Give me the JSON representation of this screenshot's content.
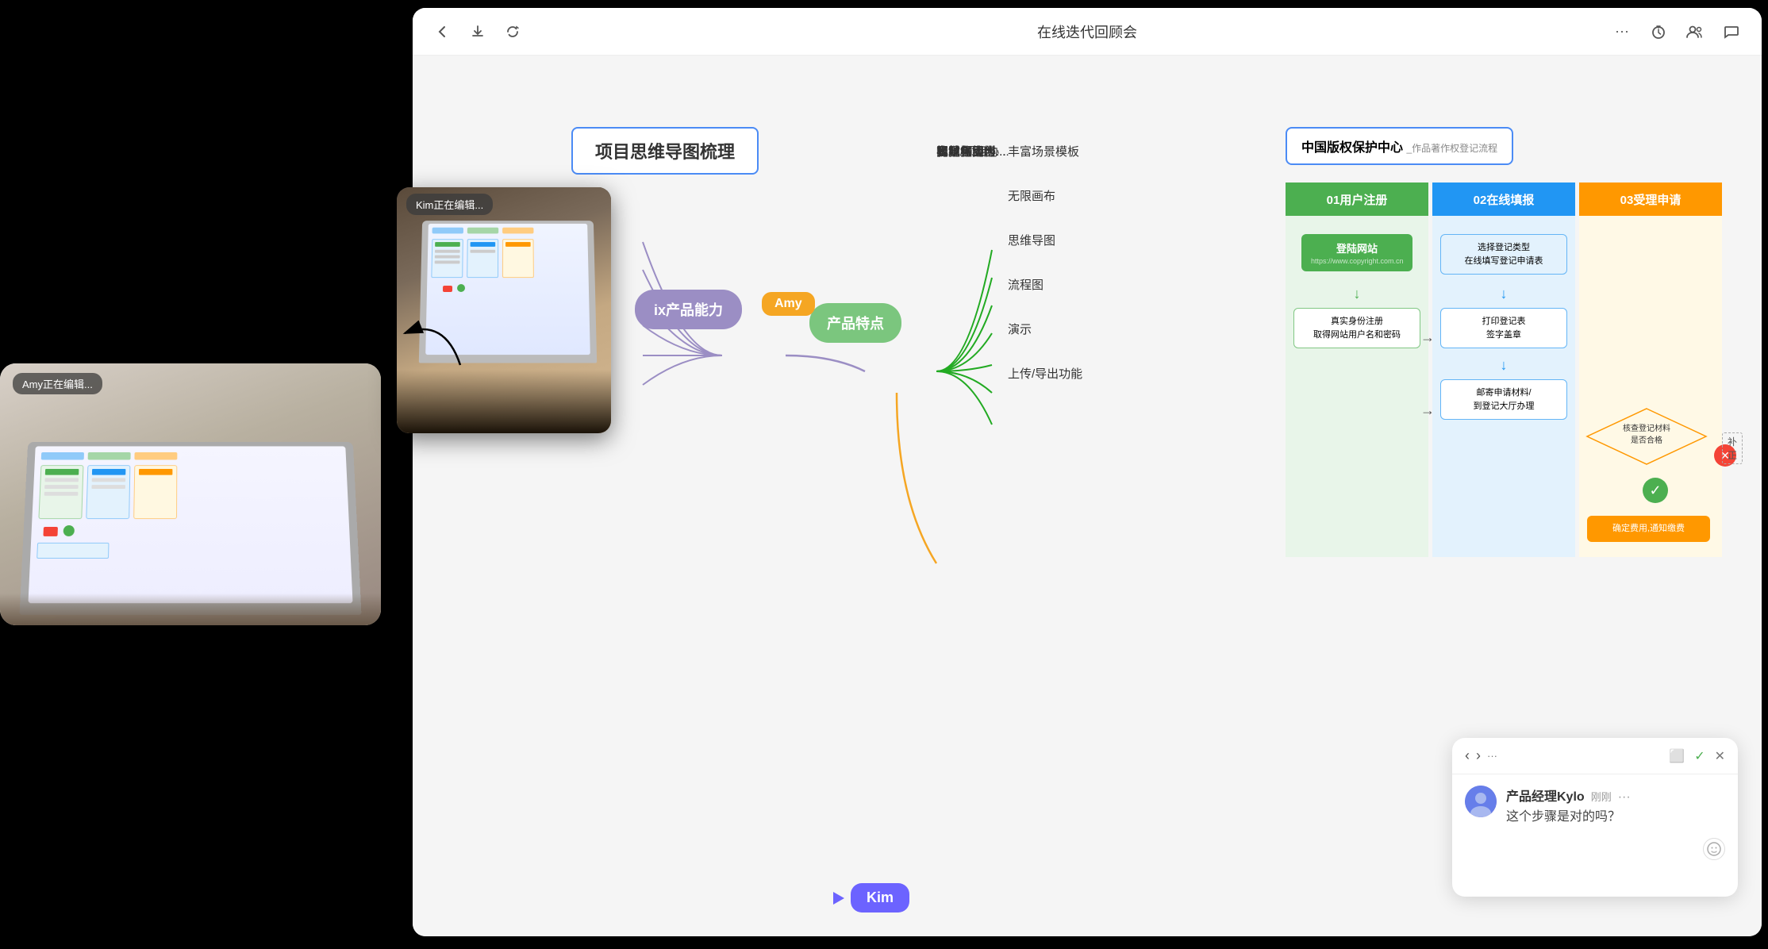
{
  "app": {
    "title": "在线迭代回顾会",
    "background": "#000000"
  },
  "titlebar": {
    "back_icon": "←",
    "download_icon": "↓",
    "sync_icon": "⟳",
    "more_icon": "···",
    "timer_icon": "⏱",
    "users_icon": "👥",
    "chat_icon": "💬"
  },
  "mindmap": {
    "title": "项目思维导图梳理",
    "central_node": "ix产品能力",
    "product_node": "产品特点",
    "amy_label": "Amy",
    "branches_left": [
      "丰富场景模板",
      "无限画布",
      "思维导图",
      "流程图",
      "演示",
      "上传/导出功能"
    ],
    "branches_right": [
      "实时在线协...",
      "异地协同",
      "视觉化协作",
      "有趣且实用...",
      "团队/项目协...",
      "简单易用、...",
      "音视频实时..."
    ]
  },
  "copyright": {
    "title": "中国版权保护中心",
    "subtitle": "_作品著作权登记流程",
    "step1": "01用户注册",
    "step2": "02在线填报",
    "step3": "03受理申请",
    "login_btn": "登陆网站",
    "login_url": "https://www.copyright.com.cn",
    "flow_items": [
      "真实身份注册\n取得网站用户名和密码",
      "选择登记类型\n在线填写登记申请表",
      "打印登记表\n签字盖章",
      "邮寄申请材料/\n到登记大厅办理",
      "核查登记材料\n是否合格",
      "确定费用,通知缴费"
    ],
    "fix_label": "补正"
  },
  "kim_panel": {
    "header": "Kim正在编辑...",
    "cursor_label": "Kim"
  },
  "amy_panel": {
    "header": "Amy正在编辑...",
    "cursor_label": "Amy"
  },
  "chat": {
    "sender_name": "产品经理Kylo",
    "sender_time": "刚刚",
    "message": "这个步骤是对的吗？",
    "more_icon": "···",
    "close_icon": "✕",
    "expand_icon": "⬜",
    "check_icon": "✓",
    "back_icon": "‹",
    "forward_icon": "›",
    "emoji_placeholder": "😊"
  }
}
